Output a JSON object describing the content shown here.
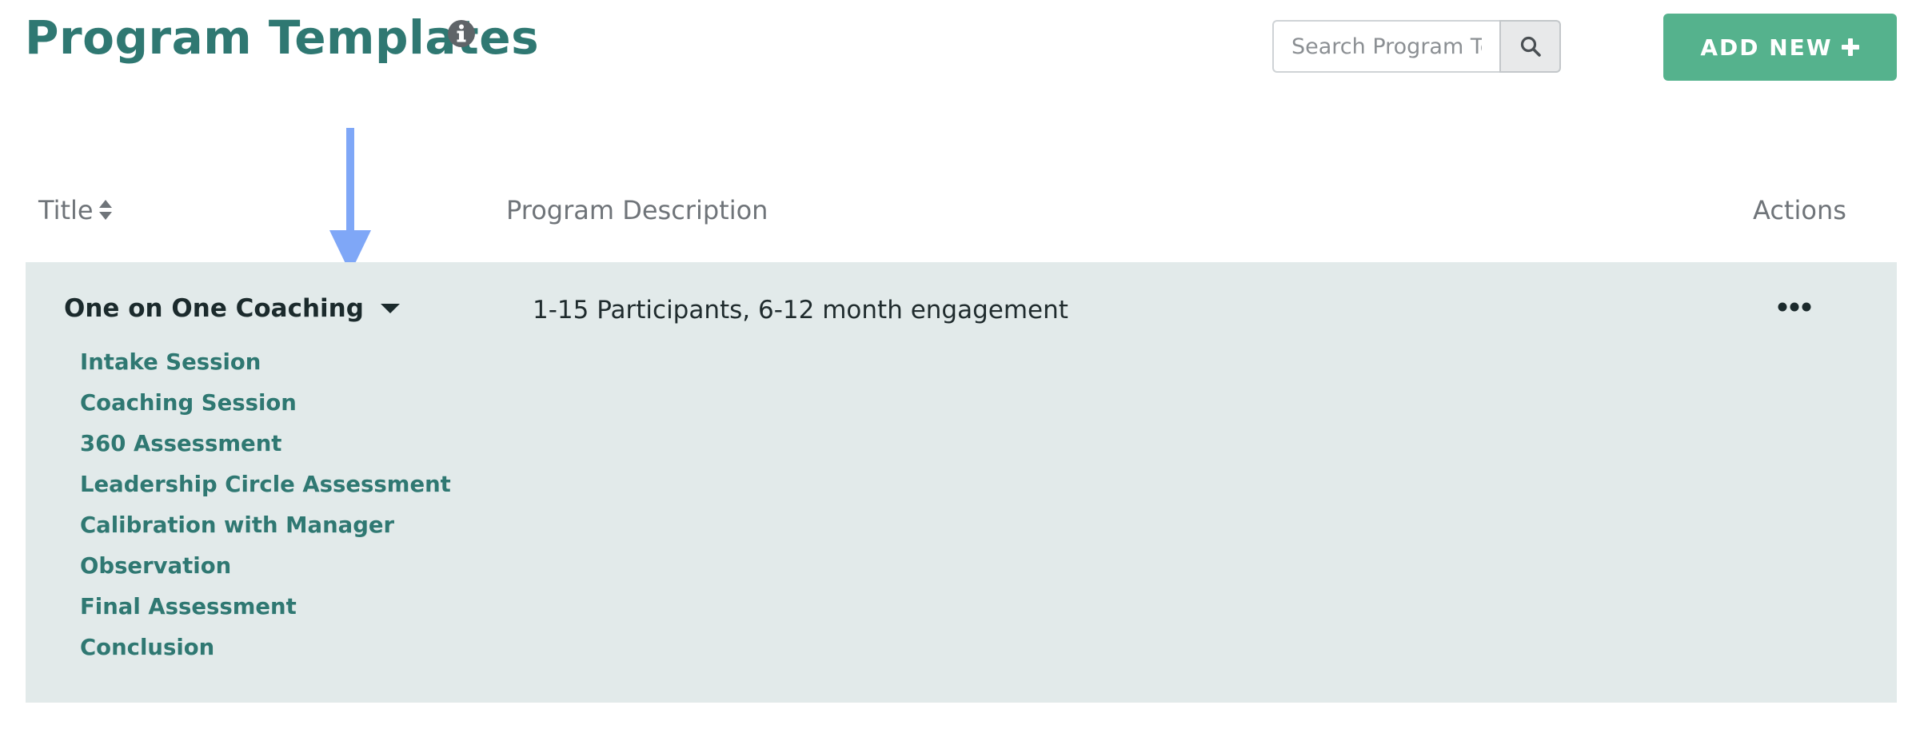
{
  "header": {
    "title": "Program Templates",
    "info_icon": "info-circle-icon",
    "search": {
      "placeholder": "Search Program Templates",
      "value": "",
      "icon": "search-icon"
    },
    "add_new_label": "ADD NEW",
    "add_new_icon": "plus-icon"
  },
  "table": {
    "columns": {
      "title": "Title",
      "description": "Program Description",
      "actions": "Actions"
    },
    "rows": [
      {
        "title": "One on One Coaching",
        "description": "1-15 Participants, 6-12 month engagement",
        "expanded": true,
        "sessions": [
          "Intake Session",
          "Coaching Session",
          "360 Assessment",
          "Leadership Circle Assessment",
          "Calibration with Manager",
          "Observation",
          "Final Assessment",
          "Conclusion"
        ]
      }
    ]
  },
  "colors": {
    "brand": "#2f7872",
    "accent_button": "#55b28d",
    "row_background": "#e2eaea",
    "header_text": "#6f7479",
    "callout_arrow": "#7fa7f7"
  }
}
